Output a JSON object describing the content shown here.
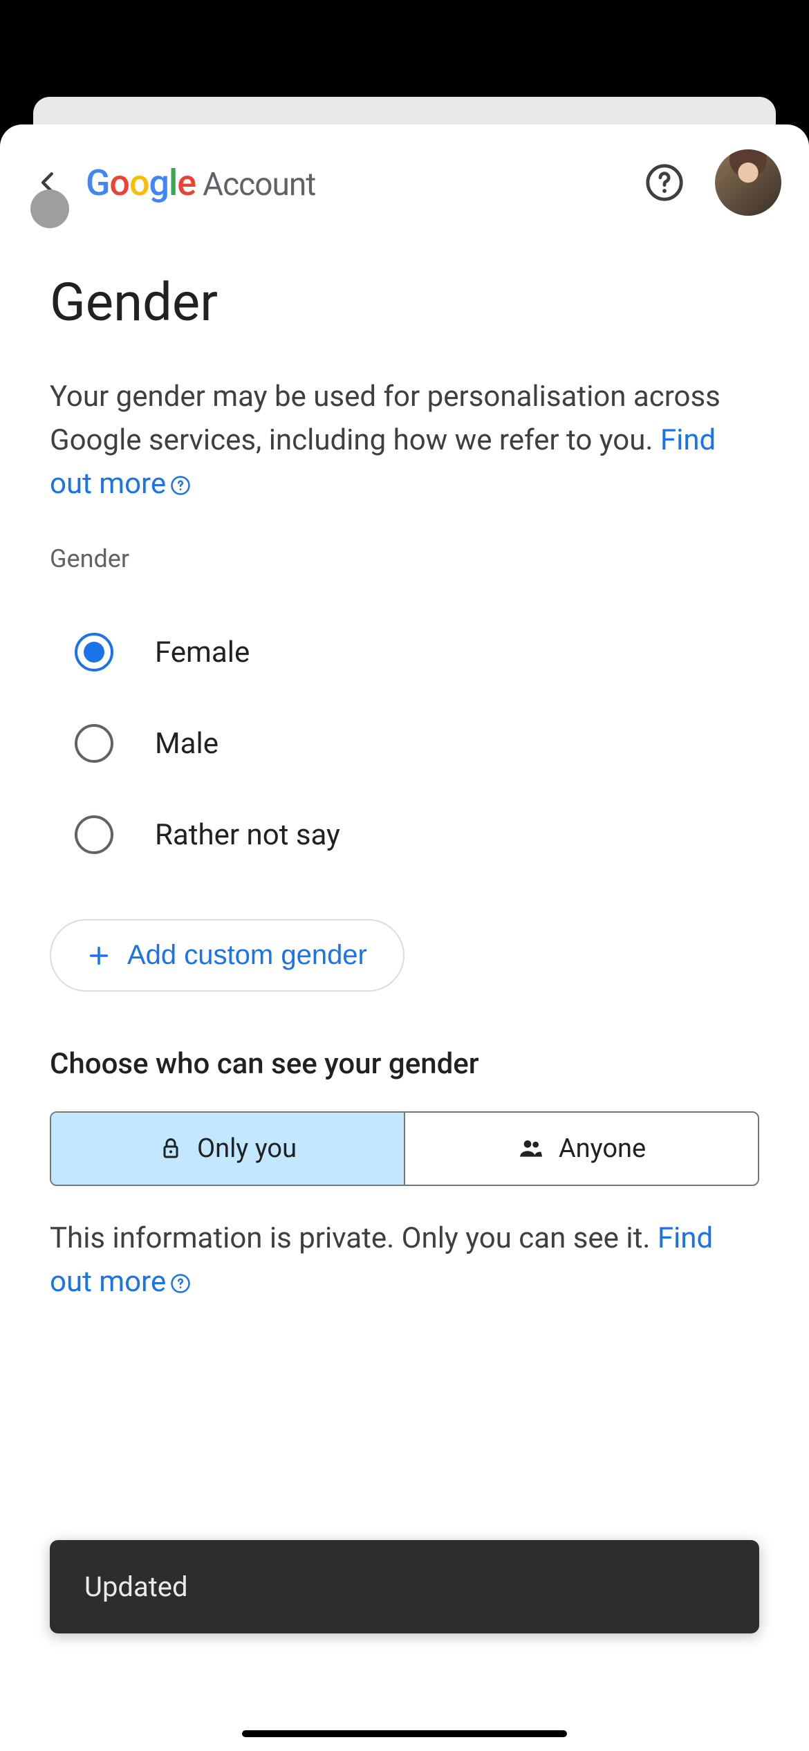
{
  "header": {
    "brand_account": "Account"
  },
  "page": {
    "title": "Gender",
    "description_prefix": "Your gender may be used for personalisation across Google services, including how we refer to you. ",
    "description_link": "Find out more",
    "section_label": "Gender"
  },
  "options": {
    "female": "Female",
    "male": "Male",
    "rather_not_say": "Rather not say",
    "selected": "female"
  },
  "custom": {
    "label": "Add custom gender"
  },
  "visibility": {
    "heading": "Choose who can see your gender",
    "only_you": "Only you",
    "anyone": "Anyone",
    "selected": "only_you"
  },
  "privacy": {
    "text_prefix": "This information is private. Only you can see it. ",
    "link": "Find out more"
  },
  "toast": {
    "message": "Updated"
  }
}
